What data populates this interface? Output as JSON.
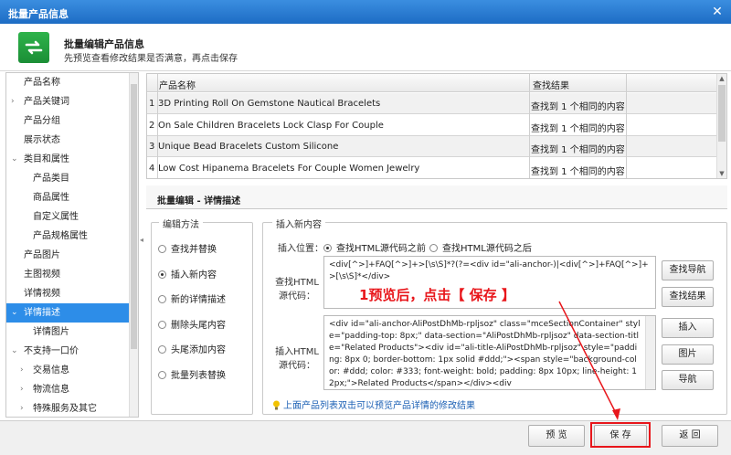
{
  "window": {
    "title": "批量产品信息"
  },
  "header": {
    "title": "批量编辑产品信息",
    "subtitle": "先预览查看修改结果是否满意，再点击保存"
  },
  "sidebar": {
    "items": [
      {
        "label": "产品名称",
        "level": 0,
        "arrow": ""
      },
      {
        "label": "产品关键词",
        "level": 0,
        "arrow": "›"
      },
      {
        "label": "产品分组",
        "level": 0,
        "arrow": ""
      },
      {
        "label": "展示状态",
        "level": 0,
        "arrow": ""
      },
      {
        "label": "类目和属性",
        "level": 0,
        "arrow": "⌄"
      },
      {
        "label": "产品类目",
        "level": 1,
        "arrow": ""
      },
      {
        "label": "商品属性",
        "level": 1,
        "arrow": ""
      },
      {
        "label": "自定义属性",
        "level": 1,
        "arrow": ""
      },
      {
        "label": "产品规格属性",
        "level": 1,
        "arrow": ""
      },
      {
        "label": "产品图片",
        "level": 0,
        "arrow": ""
      },
      {
        "label": "主图视频",
        "level": 0,
        "arrow": ""
      },
      {
        "label": "详情视频",
        "level": 0,
        "arrow": ""
      },
      {
        "label": "详情描述",
        "level": 0,
        "arrow": "⌄",
        "active": true
      },
      {
        "label": "详情图片",
        "level": 1,
        "arrow": ""
      },
      {
        "label": "不支持一口价",
        "level": 0,
        "arrow": "⌄"
      },
      {
        "label": "交易信息",
        "level": 1,
        "arrow": "›"
      },
      {
        "label": "物流信息",
        "level": 1,
        "arrow": "›"
      },
      {
        "label": "特殊服务及其它",
        "level": 1,
        "arrow": "›"
      }
    ]
  },
  "grid": {
    "columns": [
      "产品名称",
      "查找结果"
    ],
    "rows": [
      {
        "num": "1",
        "name": "3D Printing Roll On Gemstone Nautical Bracelets",
        "result": "查找到 1 个相同的内容"
      },
      {
        "num": "2",
        "name": "On Sale Children Bracelets Lock Clasp For Couple",
        "result": "查找到 1 个相同的内容"
      },
      {
        "num": "3",
        "name": "Unique Bead Bracelets Custom Silicone",
        "result": "查找到 1 个相同的内容"
      },
      {
        "num": "4",
        "name": "Low Cost Hipanema Bracelets For Couple Women Jewelry",
        "result": "查找到 1 个相同的内容"
      }
    ]
  },
  "panel": {
    "title": "批量编辑 - 详情描述"
  },
  "edit_method": {
    "legend": "编辑方法",
    "options": [
      {
        "label": "查找并替换",
        "checked": false
      },
      {
        "label": "插入新内容",
        "checked": true
      },
      {
        "label": "新的详情描述",
        "checked": false
      },
      {
        "label": "删除头尾内容",
        "checked": false
      },
      {
        "label": "头尾添加内容",
        "checked": false
      },
      {
        "label": "批量列表替换",
        "checked": false
      }
    ]
  },
  "insert": {
    "legend": "插入新内容",
    "position_label": "插入位置：",
    "position_options": [
      {
        "label": "查找HTML源代码之前",
        "checked": true
      },
      {
        "label": "查找HTML源代码之后",
        "checked": false
      }
    ],
    "find_label_1": "查找HTML",
    "find_label_2": "源代码：",
    "find_value": "<div[^>]+FAQ[^>]+>[\\s\\S]*?(?=<div id=\"ali-anchor-)|<div[^>]+FAQ[^>]+>[\\s\\S]*</div>",
    "insert_label_1": "插入HTML",
    "insert_label_2": "源代码：",
    "insert_value": "<div id=\"ali-anchor-AliPostDhMb-rpljsoz\" class=\"mceSectionContainer\" style=\"padding-top: 8px;\" data-section=\"AliPostDhMb-rpljsoz\" data-section-title=\"Related Products\"><div id=\"ali-title-AliPostDhMb-rpljsoz\" style=\"padding: 8px 0; border-bottom: 1px solid #ddd;\"><span style=\"background-color: #ddd; color: #333; font-weight: bold; padding: 8px 10px; line-height: 12px;\">Related Products</span></div><div"
  },
  "side_buttons": {
    "find_nav": "查找导航",
    "find_result": "查找结果",
    "insert": "插入",
    "image": "图片",
    "nav": "导航"
  },
  "hint": "上面产品列表双击可以预览产品详情的修改结果",
  "annotation": "1预览后，点击【 保存 】",
  "footer": {
    "preview": "预 览",
    "save": "保 存",
    "back": "返 回"
  },
  "colors": {
    "accent": "#2d8de8",
    "annotation": "#e8161b",
    "titlebar": "#1d6cc4"
  }
}
